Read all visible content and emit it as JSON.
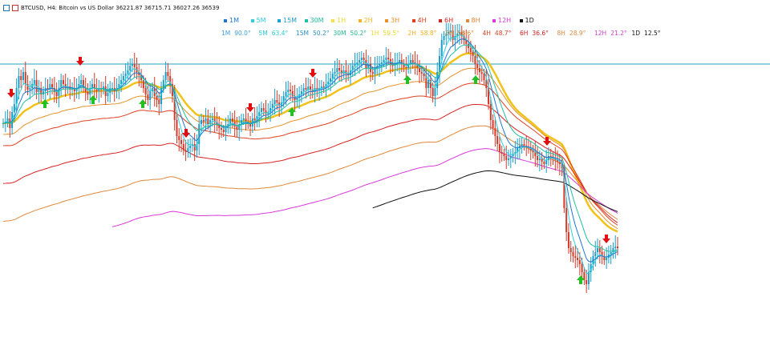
{
  "header": {
    "symbol_line": "BTCUSD, H4: Bitcoin vs US Dollar 36221.87 36715.71 36027.26 36539"
  },
  "timeframes": [
    {
      "label": "1M",
      "color": "#1f77d0"
    },
    {
      "label": "5M",
      "color": "#2bd1e0"
    },
    {
      "label": "15M",
      "color": "#1f9fd0"
    },
    {
      "label": "30M",
      "color": "#20c0a0"
    },
    {
      "label": "1H",
      "color": "#f2e23a"
    },
    {
      "label": "2H",
      "color": "#f5b21c"
    },
    {
      "label": "3H",
      "color": "#e6912a"
    },
    {
      "label": "4H",
      "color": "#e0401f"
    },
    {
      "label": "6H",
      "color": "#d82222"
    },
    {
      "label": "8H",
      "color": "#e0883a"
    },
    {
      "label": "12H",
      "color": "#d93ad9"
    },
    {
      "label": "1D",
      "color": "#111111"
    }
  ],
  "tf_values": [
    {
      "label": "1M",
      "value": "90.0°",
      "color": "#3aa0d8"
    },
    {
      "label": "5M",
      "value": "63.4°",
      "color": "#2bc8d8"
    },
    {
      "label": "15M",
      "value": "50.2°",
      "color": "#2a90c8"
    },
    {
      "label": "30M",
      "value": "50.2°",
      "color": "#20b890"
    },
    {
      "label": "1H",
      "value": "59.5°",
      "color": "#e8d830"
    },
    {
      "label": "2H",
      "value": "58.8°",
      "color": "#f0b020"
    },
    {
      "label": "3H",
      "value": "56.6°",
      "color": "#d88a30"
    },
    {
      "label": "4H",
      "value": "48.7°",
      "color": "#d84020"
    },
    {
      "label": "6H",
      "value": "36.6°",
      "color": "#d02020"
    },
    {
      "label": "8H",
      "value": "28.9°",
      "color": "#d88a40"
    },
    {
      "label": "12H",
      "value": "21.2°",
      "color": "#d040d0"
    },
    {
      "label": "1D",
      "value": "12.5°",
      "color": "#111111"
    }
  ],
  "chart_data": {
    "type": "line",
    "note_symbol": "BTCUSD H4",
    "price_line_color": "#20a0c0",
    "up_arrow_color": "#22c022",
    "down_arrow_color": "#e01010",
    "price": [
      256,
      258,
      262,
      250,
      270,
      280,
      300,
      315,
      310,
      320,
      305,
      298,
      300,
      305,
      310,
      295,
      300,
      292,
      296,
      300,
      298,
      305,
      300,
      295,
      290,
      300,
      310,
      305,
      300,
      302,
      298,
      300,
      296,
      300,
      305,
      310,
      300,
      295,
      292,
      300,
      305,
      300,
      296,
      300,
      298,
      302,
      290,
      294,
      300,
      300,
      296,
      300,
      305,
      310,
      315,
      318,
      322,
      328,
      330,
      326,
      320,
      316,
      310,
      300,
      292,
      285,
      296,
      300,
      290,
      285,
      280,
      300,
      310,
      320,
      315,
      305,
      290,
      260,
      240,
      235,
      230,
      222,
      220,
      225,
      228,
      230,
      222,
      230,
      255,
      260,
      258,
      262,
      255,
      260,
      262,
      258,
      255,
      250,
      248,
      245,
      250,
      255,
      262,
      258,
      252,
      248,
      255,
      260,
      262,
      258,
      256,
      252,
      262,
      260,
      265,
      270,
      275,
      272,
      268,
      270,
      275,
      280,
      285,
      282,
      278,
      282,
      290,
      295,
      298,
      296,
      290,
      285,
      288,
      292,
      296,
      300,
      298,
      302,
      298,
      295,
      300,
      298,
      300,
      302,
      300,
      305,
      308,
      312,
      318,
      320,
      325,
      322,
      318,
      322,
      318,
      316,
      322,
      328,
      330,
      332,
      335,
      338,
      335,
      325,
      330,
      320,
      318,
      325,
      328,
      330,
      332,
      335,
      338,
      336,
      330,
      328,
      330,
      332,
      335,
      330,
      326,
      325,
      330,
      335,
      332,
      330,
      325,
      320,
      318,
      315,
      300,
      310,
      300,
      290,
      300,
      320,
      340,
      360,
      365,
      368,
      370,
      372,
      360,
      365,
      368,
      370,
      365,
      360,
      355,
      350,
      345,
      340,
      330,
      325,
      320,
      318,
      310,
      300,
      280,
      260,
      250,
      240,
      230,
      220,
      218,
      215,
      210,
      212,
      215,
      218,
      220,
      225,
      228,
      230,
      228,
      226,
      225,
      222,
      220,
      215,
      210,
      212,
      208,
      205,
      210,
      215,
      214,
      212,
      210,
      208,
      205,
      200,
      150,
      120,
      100,
      95,
      90,
      88,
      85,
      80,
      70,
      60,
      55,
      70,
      80,
      90,
      95,
      100,
      95,
      90,
      85,
      88,
      92,
      95,
      100,
      102,
      100
    ],
    "ema_lines": [
      {
        "name": "2H",
        "color": "#f2c21a"
      },
      {
        "name": "3H",
        "color": "#e6912a"
      },
      {
        "name": "4H",
        "color": "#e0401f"
      },
      {
        "name": "6H",
        "color": "#d82222"
      },
      {
        "name": "8H",
        "color": "#e0883a"
      },
      {
        "name": "12H",
        "color": "#d93ad9"
      },
      {
        "name": "1D",
        "color": "#111111"
      }
    ],
    "up_arrows": [
      56,
      116,
      178,
      364,
      508,
      593,
      724
    ],
    "down_arrows": [
      14,
      100,
      232,
      312,
      390,
      682,
      756
    ]
  }
}
